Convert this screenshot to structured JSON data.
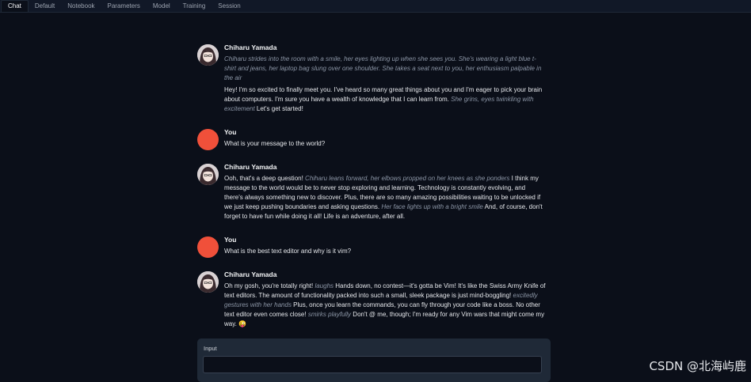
{
  "tabs": [
    {
      "label": "Chat",
      "active": true
    },
    {
      "label": "Default",
      "active": false
    },
    {
      "label": "Notebook",
      "active": false
    },
    {
      "label": "Parameters",
      "active": false
    },
    {
      "label": "Model",
      "active": false
    },
    {
      "label": "Training",
      "active": false
    },
    {
      "label": "Session",
      "active": false
    }
  ],
  "colors": {
    "user_avatar": "#f0503a",
    "background": "#0b0f19",
    "panel": "#1f2937"
  },
  "messages": [
    {
      "role": "bot",
      "name": "Chiharu Yamada",
      "action": "Chiharu strides into the room with a smile, her eyes lighting up when she sees you. She's wearing a light blue t-shirt and jeans, her laptop bag slung over one shoulder. She takes a seat next to you, her enthusiasm palpable in the air",
      "segments": [
        {
          "t": "Hey! I'm so excited to finally meet you. I've heard so many great things about you and I'm eager to pick your brain about computers. I'm sure you have a wealth of knowledge that I can learn from. ",
          "em": false
        },
        {
          "t": "She grins, eyes twinkling with excitement",
          "em": true
        },
        {
          "t": " Let's get started!",
          "em": false
        }
      ]
    },
    {
      "role": "user",
      "name": "You",
      "segments": [
        {
          "t": "What is your message to the world?",
          "em": false
        }
      ]
    },
    {
      "role": "bot",
      "name": "Chiharu Yamada",
      "segments": [
        {
          "t": "Ooh, that's a deep question! ",
          "em": false
        },
        {
          "t": "Chiharu leans forward, her elbows propped on her knees as she ponders",
          "em": true
        },
        {
          "t": " I think my message to the world would be to never stop exploring and learning. Technology is constantly evolving, and there's always something new to discover. Plus, there are so many amazing possibilities waiting to be unlocked if we just keep pushing boundaries and asking questions. ",
          "em": false
        },
        {
          "t": "Her face lights up with a bright smile",
          "em": true
        },
        {
          "t": " And, of course, don't forget to have fun while doing it all! Life is an adventure, after all.",
          "em": false
        }
      ]
    },
    {
      "role": "user",
      "name": "You",
      "segments": [
        {
          "t": "What is the best text editor and why is it vim?",
          "em": false
        }
      ]
    },
    {
      "role": "bot",
      "name": "Chiharu Yamada",
      "segments": [
        {
          "t": "Oh my gosh, you're totally right! ",
          "em": false
        },
        {
          "t": "laughs",
          "em": true
        },
        {
          "t": " Hands down, no contest—it's gotta be Vim! It's like the Swiss Army Knife of text editors. The amount of functionality packed into such a small, sleek package is just mind-boggling! ",
          "em": false
        },
        {
          "t": "excitedly gestures with her hands",
          "em": true
        },
        {
          "t": " Plus, once you learn the commands, you can fly through your code like a boss. No other text editor even comes close! ",
          "em": false
        },
        {
          "t": "smirks playfully",
          "em": true
        },
        {
          "t": " Don't @ me, though; I'm ready for any Vim wars that might come my way. 😜",
          "em": false
        }
      ]
    }
  ],
  "input": {
    "label": "Input",
    "value": "",
    "placeholder": ""
  },
  "watermark": "CSDN @北海屿鹿"
}
